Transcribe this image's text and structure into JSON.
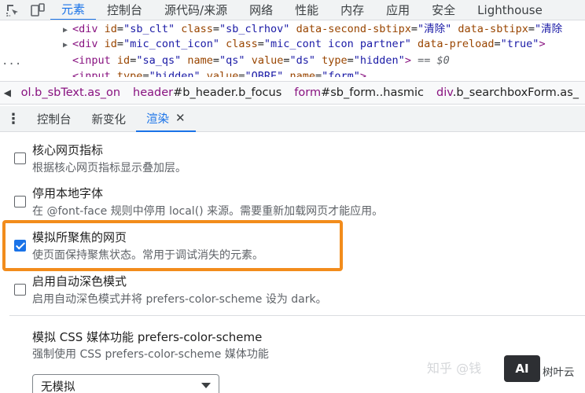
{
  "topbar": {
    "tabs": [
      "元素",
      "控制台",
      "源代码/来源",
      "网络",
      "性能",
      "内存",
      "应用",
      "安全",
      "Lighthouse"
    ],
    "active_index": 0
  },
  "code": {
    "line1": {
      "tag": "<div",
      "a1": "id",
      "v1": "\"sb_clt\"",
      "a2": "class",
      "v2": "\"sb_clrhov\"",
      "a3": "data-second-sbtipx",
      "v3": "\"清除\"",
      "a4": "data-sbtipx",
      "v4": "\"清除"
    },
    "line2": {
      "tag": "<div",
      "a1": "id",
      "v1": "\"mic_cont_icon\"",
      "a2": "class",
      "v2": "\"mic_cont icon partner\"",
      "a3": "data-preload",
      "v3": "\"true\"",
      "end": ">"
    },
    "line3": {
      "tag": "<input",
      "a1": "id",
      "v1": "\"sa_qs\"",
      "a2": "name",
      "v2": "\"qs\"",
      "a3": "value",
      "v3": "\"ds\"",
      "a4": "type",
      "v4": "\"hidden\"",
      "end": ">",
      "suffix": "== $0"
    },
    "line4": {
      "tag": "<input",
      "a1": "type",
      "v1": "\"hidden\"",
      "a2": "value",
      "v2": "\"QBRE\"",
      "a3": "name",
      "v3": "\"form\"",
      "end": ">"
    },
    "dots": "..."
  },
  "breadcrumbs": [
    {
      "tag": "",
      "rest": "ol.b_sbText.as_on"
    },
    {
      "tag": "header",
      "rest": "#b_header.b_focus"
    },
    {
      "tag": "form",
      "rest": "#sb_form..hasmic"
    },
    {
      "tag": "div",
      "rest": ".b_searchboxForm.as_"
    }
  ],
  "drawer": {
    "tabs": [
      "控制台",
      "新变化",
      "渲染"
    ],
    "active_index": 2,
    "close_glyph": "✕"
  },
  "options": [
    {
      "title": "核心网页指标",
      "desc": "根据核心网页指标显示叠加层。",
      "checked": false
    },
    {
      "title": "停用本地字体",
      "desc": "在 @font-face 规则中停用 local() 来源。需要重新加载网页才能应用。",
      "checked": false
    },
    {
      "title": "模拟所聚焦的网页",
      "desc": "使页面保持聚焦状态。常用于调试消失的元素。",
      "checked": true
    },
    {
      "title": "启用自动深色模式",
      "desc": "启用自动深色模式并将 prefers-color-scheme 设为 dark。",
      "checked": false
    }
  ],
  "emulate": {
    "title": "模拟 CSS 媒体功能 prefers-color-scheme",
    "desc": "强制使用 CSS prefers-color-scheme 媒体功能",
    "select_value": "无模拟"
  },
  "watermark": {
    "text": "知乎 @钱",
    "logo": "AI",
    "brand": "树叶云"
  },
  "colors": {
    "accent": "#1a73e8",
    "highlight": "#f28c1c",
    "tag": "#881280",
    "attr": "#994500",
    "value": "#1a1aa6"
  }
}
